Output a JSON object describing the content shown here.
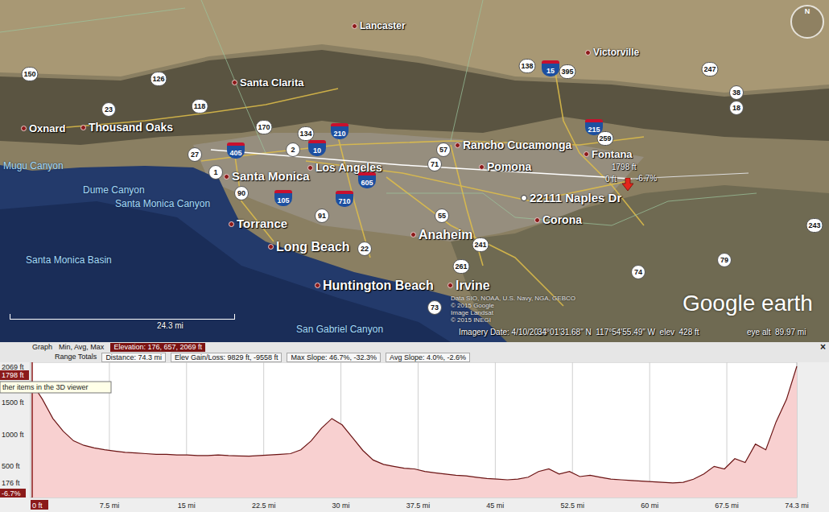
{
  "map": {
    "cities": [
      {
        "label": "Lancaster"
      },
      {
        "label": "Victorville"
      },
      {
        "label": "Santa Clarita"
      },
      {
        "label": "Oxnard"
      },
      {
        "label": "Thousand Oaks"
      },
      {
        "label": "Rancho Cucamonga"
      },
      {
        "label": "Fontana"
      },
      {
        "label": "Los Angeles"
      },
      {
        "label": "Pomona"
      },
      {
        "label": "Santa Monica"
      },
      {
        "label": "Torrance"
      },
      {
        "label": "Corona"
      },
      {
        "label": "Long Beach"
      },
      {
        "label": "Anaheim"
      },
      {
        "label": "Huntington Beach"
      },
      {
        "label": "Irvine"
      }
    ],
    "placemark": {
      "label": "22111 Naples Dr"
    },
    "water_labels": [
      {
        "label": "Mugu Canyon"
      },
      {
        "label": "Dume Canyon"
      },
      {
        "label": "Santa Monica Canyon"
      },
      {
        "label": "Santa Monica Basin"
      },
      {
        "label": "San Gabriel Canyon"
      }
    ],
    "shields": [
      {
        "label": "150",
        "kind": "state"
      },
      {
        "label": "126",
        "kind": "state"
      },
      {
        "label": "23",
        "kind": "state"
      },
      {
        "label": "118",
        "kind": "state"
      },
      {
        "label": "170",
        "kind": "state"
      },
      {
        "label": "134",
        "kind": "state"
      },
      {
        "label": "210",
        "kind": "interstate"
      },
      {
        "label": "405",
        "kind": "interstate"
      },
      {
        "label": "27",
        "kind": "state"
      },
      {
        "label": "2",
        "kind": "state"
      },
      {
        "label": "10",
        "kind": "interstate"
      },
      {
        "label": "1",
        "kind": "state"
      },
      {
        "label": "90",
        "kind": "state"
      },
      {
        "label": "105",
        "kind": "interstate"
      },
      {
        "label": "710",
        "kind": "interstate"
      },
      {
        "label": "605",
        "kind": "interstate"
      },
      {
        "label": "57",
        "kind": "state"
      },
      {
        "label": "71",
        "kind": "state"
      },
      {
        "label": "91",
        "kind": "state"
      },
      {
        "label": "55",
        "kind": "state"
      },
      {
        "label": "22",
        "kind": "state"
      },
      {
        "label": "241",
        "kind": "state"
      },
      {
        "label": "261",
        "kind": "state"
      },
      {
        "label": "73",
        "kind": "state"
      },
      {
        "label": "138",
        "kind": "state"
      },
      {
        "label": "15",
        "kind": "interstate"
      },
      {
        "label": "395",
        "kind": "state"
      },
      {
        "label": "247",
        "kind": "state"
      },
      {
        "label": "38",
        "kind": "state"
      },
      {
        "label": "18",
        "kind": "state"
      },
      {
        "label": "215",
        "kind": "interstate"
      },
      {
        "label": "259",
        "kind": "state"
      },
      {
        "label": "243",
        "kind": "state"
      },
      {
        "label": "74",
        "kind": "state"
      },
      {
        "label": "79",
        "kind": "state"
      }
    ],
    "path": {
      "elevation": "1798 ft",
      "distance": "0 ft",
      "slope": "-6.7%"
    },
    "compass": "N",
    "scale": "24.3 mi",
    "attribution": [
      "Data SIO, NOAA, U.S. Navy, NGA, GEBCO",
      "© 2015 Google",
      "Image Landsat",
      "© 2015 INEGI"
    ],
    "logo": "Google earth",
    "status": {
      "imagery_date": "Imagery Date: 4/10/2013",
      "coordinates": "34°01'31.68\" N  117°54'55.49\" W  elev  428 ft",
      "eye_alt": "eye alt  89.97 mi"
    }
  },
  "profile": {
    "graph": "Graph",
    "stats_menu": "Min, Avg, Max",
    "elevation_stats": {
      "text": "Elevation: 176, 657, 2069 ft",
      "selected": true
    },
    "range_totals": {
      "label": "Range Totals",
      "items": [
        "Distance: 74.3 mi",
        "Elev Gain/Loss: 9829 ft, -9558 ft",
        "Max Slope: 46.7%, -32.3%",
        "Avg Slope: 4.0%, -2.6%"
      ]
    },
    "close": "×",
    "y_ticks": [
      {
        "label": "2069 ft",
        "value": 2069
      },
      {
        "label": "1500 ft",
        "value": 1500
      },
      {
        "label": "1000 ft",
        "value": 1000
      },
      {
        "label": "500 ft",
        "value": 500
      },
      {
        "label": "176 ft",
        "value": 176
      }
    ],
    "x_ticks": [
      {
        "label": "7.5 mi",
        "value": 7.5
      },
      {
        "label": "15 mi",
        "value": 15
      },
      {
        "label": "22.5 mi",
        "value": 22.5
      },
      {
        "label": "30 mi",
        "value": 30
      },
      {
        "label": "37.5 mi",
        "value": 37.5
      },
      {
        "label": "45 mi",
        "value": 45
      },
      {
        "label": "52.5 mi",
        "value": 52.5
      },
      {
        "label": "60 mi",
        "value": 60
      },
      {
        "label": "67.5 mi",
        "value": 67.5
      },
      {
        "label": "74.3 mi",
        "value": 74.3
      }
    ],
    "cursor": {
      "distance": "0 ft",
      "elevation": "1798 ft",
      "slope": "-6.7%",
      "at": 0
    },
    "elevation_ft": [
      1798,
      1550,
      1250,
      1050,
      900,
      830,
      790,
      760,
      740,
      720,
      710,
      700,
      690,
      690,
      680,
      680,
      670,
      670,
      680,
      670,
      665,
      660,
      670,
      680,
      690,
      700,
      760,
      900,
      1100,
      1250,
      1150,
      950,
      750,
      600,
      530,
      500,
      470,
      460,
      420,
      400,
      380,
      360,
      350,
      330,
      310,
      300,
      290,
      300,
      330,
      420,
      460,
      380,
      420,
      340,
      360,
      330,
      300,
      290,
      280,
      270,
      260,
      250,
      240,
      250,
      300,
      380,
      500,
      460,
      620,
      560,
      850,
      760,
      1200,
      1550,
      2069
    ],
    "tooltip": "ther items in the 3D viewer"
  }
}
